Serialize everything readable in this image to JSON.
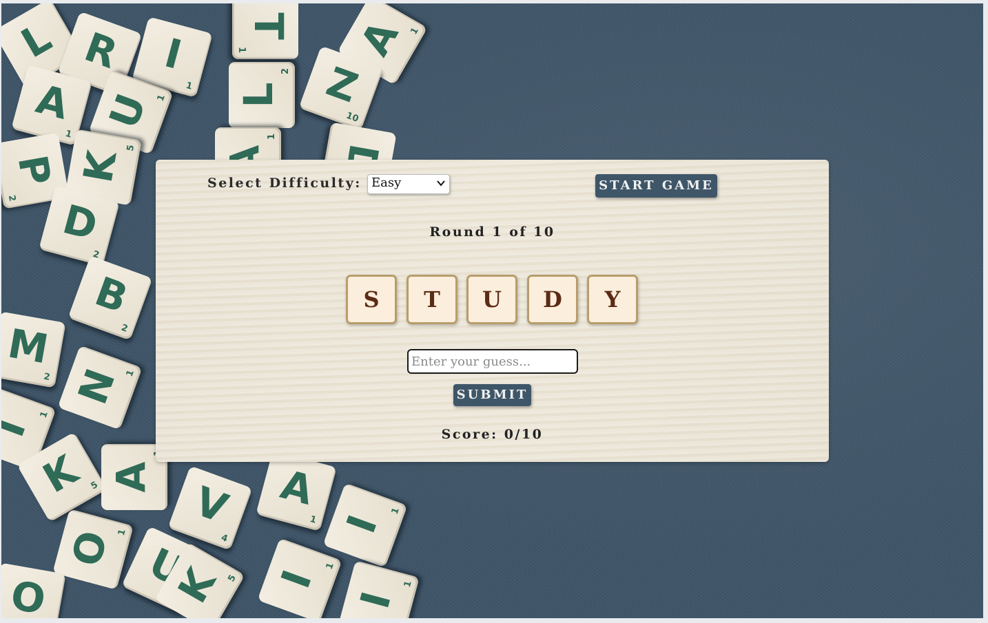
{
  "controls": {
    "difficulty_label": "Select Difficulty:",
    "difficulty_selected": "Easy",
    "start_label": "START GAME"
  },
  "game": {
    "round_text": "Round 1 of 10",
    "letters": [
      "S",
      "T",
      "U",
      "D",
      "Y"
    ],
    "guess_placeholder": "Enter your guess...",
    "guess_value": "",
    "submit_label": "SUBMIT",
    "score_text": "Score: 0/10"
  },
  "background": {
    "tiles": [
      {
        "letter": "L",
        "points": "2"
      },
      {
        "letter": "R",
        "points": "1"
      },
      {
        "letter": "I",
        "points": "1"
      },
      {
        "letter": "T",
        "points": "1"
      },
      {
        "letter": "A",
        "points": "1"
      },
      {
        "letter": "Z",
        "points": "10"
      },
      {
        "letter": "A",
        "points": "1"
      },
      {
        "letter": "U",
        "points": "1"
      },
      {
        "letter": "L",
        "points": "2"
      },
      {
        "letter": "P",
        "points": "2"
      },
      {
        "letter": "K",
        "points": "5"
      },
      {
        "letter": "A",
        "points": "1"
      },
      {
        "letter": "D",
        "points": "2"
      },
      {
        "letter": "B",
        "points": "2"
      },
      {
        "letter": "M",
        "points": "2"
      },
      {
        "letter": "N",
        "points": "1"
      },
      {
        "letter": "I",
        "points": "1"
      },
      {
        "letter": "K",
        "points": "5"
      },
      {
        "letter": "A",
        "points": "1"
      },
      {
        "letter": "V",
        "points": "4"
      },
      {
        "letter": "A",
        "points": "1"
      },
      {
        "letter": "I",
        "points": "1"
      },
      {
        "letter": "O",
        "points": "1"
      },
      {
        "letter": "U",
        "points": "1"
      },
      {
        "letter": "I",
        "points": "1"
      },
      {
        "letter": "I",
        "points": "1"
      },
      {
        "letter": "D",
        "points": "2"
      },
      {
        "letter": "K",
        "points": "5"
      },
      {
        "letter": "O",
        "points": "1"
      }
    ]
  },
  "colors": {
    "background": "#3d5467",
    "button": "#3e5668",
    "tile_letter": "#2f6b57",
    "letter_box_border": "#b89d6b",
    "letter_text": "#5b2b14"
  }
}
